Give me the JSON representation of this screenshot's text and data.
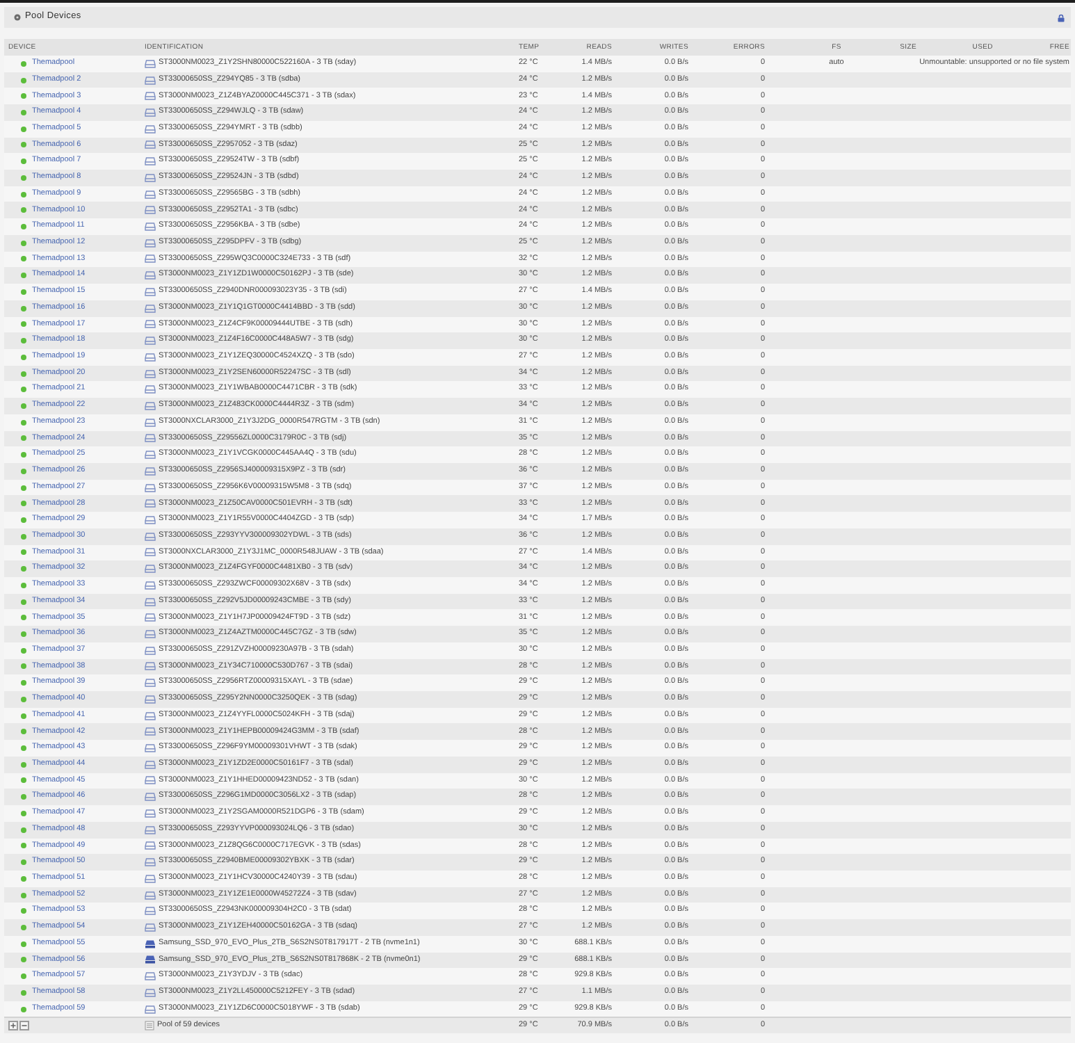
{
  "panel": {
    "title": "Pool Devices"
  },
  "table": {
    "columns": [
      "DEVICE",
      "IDENTIFICATION",
      "TEMP",
      "READS",
      "WRITES",
      "ERRORS",
      "FS",
      "SIZE",
      "USED",
      "FREE"
    ],
    "rows": [
      {
        "device": "Themadpool",
        "kind": "hdd",
        "identification": "ST3000NM0023_Z1Y2SHN80000C522160A - 3 TB (sday)",
        "temp": "22 °C",
        "reads": "1.4 MB/s",
        "writes": "0.0 B/s",
        "errors": "0",
        "fs": "auto",
        "mount_status": "Unmountable: unsupported or no file system"
      },
      {
        "device": "Themadpool 2",
        "kind": "hdd",
        "identification": "ST33000650SS_Z294YQ85 - 3 TB (sdba)",
        "temp": "24 °C",
        "reads": "1.2 MB/s",
        "writes": "0.0 B/s",
        "errors": "0"
      },
      {
        "device": "Themadpool 3",
        "kind": "hdd",
        "identification": "ST3000NM0023_Z1Z4BYAZ0000C445C371 - 3 TB (sdax)",
        "temp": "23 °C",
        "reads": "1.4 MB/s",
        "writes": "0.0 B/s",
        "errors": "0"
      },
      {
        "device": "Themadpool 4",
        "kind": "hdd",
        "identification": "ST33000650SS_Z294WJLQ - 3 TB (sdaw)",
        "temp": "24 °C",
        "reads": "1.2 MB/s",
        "writes": "0.0 B/s",
        "errors": "0"
      },
      {
        "device": "Themadpool 5",
        "kind": "hdd",
        "identification": "ST33000650SS_Z294YMRT - 3 TB (sdbb)",
        "temp": "24 °C",
        "reads": "1.2 MB/s",
        "writes": "0.0 B/s",
        "errors": "0"
      },
      {
        "device": "Themadpool 6",
        "kind": "hdd",
        "identification": "ST33000650SS_Z2957052 - 3 TB (sdaz)",
        "temp": "25 °C",
        "reads": "1.2 MB/s",
        "writes": "0.0 B/s",
        "errors": "0"
      },
      {
        "device": "Themadpool 7",
        "kind": "hdd",
        "identification": "ST33000650SS_Z29524TW - 3 TB (sdbf)",
        "temp": "25 °C",
        "reads": "1.2 MB/s",
        "writes": "0.0 B/s",
        "errors": "0"
      },
      {
        "device": "Themadpool 8",
        "kind": "hdd",
        "identification": "ST33000650SS_Z29524JN - 3 TB (sdbd)",
        "temp": "24 °C",
        "reads": "1.2 MB/s",
        "writes": "0.0 B/s",
        "errors": "0"
      },
      {
        "device": "Themadpool 9",
        "kind": "hdd",
        "identification": "ST33000650SS_Z29565BG - 3 TB (sdbh)",
        "temp": "24 °C",
        "reads": "1.2 MB/s",
        "writes": "0.0 B/s",
        "errors": "0"
      },
      {
        "device": "Themadpool 10",
        "kind": "hdd",
        "identification": "ST33000650SS_Z2952TA1 - 3 TB (sdbc)",
        "temp": "24 °C",
        "reads": "1.2 MB/s",
        "writes": "0.0 B/s",
        "errors": "0"
      },
      {
        "device": "Themadpool 11",
        "kind": "hdd",
        "identification": "ST33000650SS_Z2956KBA - 3 TB (sdbe)",
        "temp": "24 °C",
        "reads": "1.2 MB/s",
        "writes": "0.0 B/s",
        "errors": "0"
      },
      {
        "device": "Themadpool 12",
        "kind": "hdd",
        "identification": "ST33000650SS_Z295DPFV - 3 TB (sdbg)",
        "temp": "25 °C",
        "reads": "1.2 MB/s",
        "writes": "0.0 B/s",
        "errors": "0"
      },
      {
        "device": "Themadpool 13",
        "kind": "hdd",
        "identification": "ST33000650SS_Z295WQ3C0000C324E733 - 3 TB (sdf)",
        "temp": "32 °C",
        "reads": "1.2 MB/s",
        "writes": "0.0 B/s",
        "errors": "0"
      },
      {
        "device": "Themadpool 14",
        "kind": "hdd",
        "identification": "ST3000NM0023_Z1Y1ZD1W0000C50162PJ - 3 TB (sde)",
        "temp": "30 °C",
        "reads": "1.2 MB/s",
        "writes": "0.0 B/s",
        "errors": "0"
      },
      {
        "device": "Themadpool 15",
        "kind": "hdd",
        "identification": "ST33000650SS_Z2940DNR000093023Y35 - 3 TB (sdi)",
        "temp": "27 °C",
        "reads": "1.4 MB/s",
        "writes": "0.0 B/s",
        "errors": "0"
      },
      {
        "device": "Themadpool 16",
        "kind": "hdd",
        "identification": "ST3000NM0023_Z1Y1Q1GT0000C4414BBD - 3 TB (sdd)",
        "temp": "30 °C",
        "reads": "1.2 MB/s",
        "writes": "0.0 B/s",
        "errors": "0"
      },
      {
        "device": "Themadpool 17",
        "kind": "hdd",
        "identification": "ST3000NM0023_Z1Z4CF9K00009444UTBE - 3 TB (sdh)",
        "temp": "30 °C",
        "reads": "1.2 MB/s",
        "writes": "0.0 B/s",
        "errors": "0"
      },
      {
        "device": "Themadpool 18",
        "kind": "hdd",
        "identification": "ST3000NM0023_Z1Z4F16C0000C448A5W7 - 3 TB (sdg)",
        "temp": "30 °C",
        "reads": "1.2 MB/s",
        "writes": "0.0 B/s",
        "errors": "0"
      },
      {
        "device": "Themadpool 19",
        "kind": "hdd",
        "identification": "ST3000NM0023_Z1Y1ZEQ30000C4524XZQ - 3 TB (sdo)",
        "temp": "27 °C",
        "reads": "1.2 MB/s",
        "writes": "0.0 B/s",
        "errors": "0"
      },
      {
        "device": "Themadpool 20",
        "kind": "hdd",
        "identification": "ST3000NM0023_Z1Y2SEN60000R52247SC - 3 TB (sdl)",
        "temp": "34 °C",
        "reads": "1.2 MB/s",
        "writes": "0.0 B/s",
        "errors": "0"
      },
      {
        "device": "Themadpool 21",
        "kind": "hdd",
        "identification": "ST3000NM0023_Z1Y1WBAB0000C4471CBR - 3 TB (sdk)",
        "temp": "33 °C",
        "reads": "1.2 MB/s",
        "writes": "0.0 B/s",
        "errors": "0"
      },
      {
        "device": "Themadpool 22",
        "kind": "hdd",
        "identification": "ST3000NM0023_Z1Z483CK0000C4444R3Z - 3 TB (sdm)",
        "temp": "34 °C",
        "reads": "1.2 MB/s",
        "writes": "0.0 B/s",
        "errors": "0"
      },
      {
        "device": "Themadpool 23",
        "kind": "hdd",
        "identification": "ST3000NXCLAR3000_Z1Y3J2DG_0000R547RGTM - 3 TB (sdn)",
        "temp": "31 °C",
        "reads": "1.2 MB/s",
        "writes": "0.0 B/s",
        "errors": "0"
      },
      {
        "device": "Themadpool 24",
        "kind": "hdd",
        "identification": "ST33000650SS_Z29556ZL0000C3179R0C - 3 TB (sdj)",
        "temp": "35 °C",
        "reads": "1.2 MB/s",
        "writes": "0.0 B/s",
        "errors": "0"
      },
      {
        "device": "Themadpool 25",
        "kind": "hdd",
        "identification": "ST3000NM0023_Z1Y1VCGK0000C445AA4Q - 3 TB (sdu)",
        "temp": "28 °C",
        "reads": "1.2 MB/s",
        "writes": "0.0 B/s",
        "errors": "0"
      },
      {
        "device": "Themadpool 26",
        "kind": "hdd",
        "identification": "ST33000650SS_Z2956SJ400009315X9PZ - 3 TB (sdr)",
        "temp": "36 °C",
        "reads": "1.2 MB/s",
        "writes": "0.0 B/s",
        "errors": "0"
      },
      {
        "device": "Themadpool 27",
        "kind": "hdd",
        "identification": "ST33000650SS_Z2956K6V00009315W5M8 - 3 TB (sdq)",
        "temp": "37 °C",
        "reads": "1.2 MB/s",
        "writes": "0.0 B/s",
        "errors": "0"
      },
      {
        "device": "Themadpool 28",
        "kind": "hdd",
        "identification": "ST3000NM0023_Z1Z50CAV0000C501EVRH - 3 TB (sdt)",
        "temp": "33 °C",
        "reads": "1.2 MB/s",
        "writes": "0.0 B/s",
        "errors": "0"
      },
      {
        "device": "Themadpool 29",
        "kind": "hdd",
        "identification": "ST3000NM0023_Z1Y1R55V0000C4404ZGD - 3 TB (sdp)",
        "temp": "34 °C",
        "reads": "1.7 MB/s",
        "writes": "0.0 B/s",
        "errors": "0"
      },
      {
        "device": "Themadpool 30",
        "kind": "hdd",
        "identification": "ST33000650SS_Z293YYV300009302YDWL - 3 TB (sds)",
        "temp": "36 °C",
        "reads": "1.2 MB/s",
        "writes": "0.0 B/s",
        "errors": "0"
      },
      {
        "device": "Themadpool 31",
        "kind": "hdd",
        "identification": "ST3000NXCLAR3000_Z1Y3J1MC_0000R548JUAW - 3 TB (sdaa)",
        "temp": "27 °C",
        "reads": "1.4 MB/s",
        "writes": "0.0 B/s",
        "errors": "0"
      },
      {
        "device": "Themadpool 32",
        "kind": "hdd",
        "identification": "ST3000NM0023_Z1Z4FGYF0000C4481XB0 - 3 TB (sdv)",
        "temp": "34 °C",
        "reads": "1.2 MB/s",
        "writes": "0.0 B/s",
        "errors": "0"
      },
      {
        "device": "Themadpool 33",
        "kind": "hdd",
        "identification": "ST33000650SS_Z293ZWCF00009302X68V - 3 TB (sdx)",
        "temp": "34 °C",
        "reads": "1.2 MB/s",
        "writes": "0.0 B/s",
        "errors": "0"
      },
      {
        "device": "Themadpool 34",
        "kind": "hdd",
        "identification": "ST33000650SS_Z292V5JD00009243CMBE - 3 TB (sdy)",
        "temp": "33 °C",
        "reads": "1.2 MB/s",
        "writes": "0.0 B/s",
        "errors": "0"
      },
      {
        "device": "Themadpool 35",
        "kind": "hdd",
        "identification": "ST3000NM0023_Z1Y1H7JP00009424FT9D - 3 TB (sdz)",
        "temp": "31 °C",
        "reads": "1.2 MB/s",
        "writes": "0.0 B/s",
        "errors": "0"
      },
      {
        "device": "Themadpool 36",
        "kind": "hdd",
        "identification": "ST3000NM0023_Z1Z4AZTM0000C445C7GZ - 3 TB (sdw)",
        "temp": "35 °C",
        "reads": "1.2 MB/s",
        "writes": "0.0 B/s",
        "errors": "0"
      },
      {
        "device": "Themadpool 37",
        "kind": "hdd",
        "identification": "ST33000650SS_Z291ZVZH00009230A97B - 3 TB (sdah)",
        "temp": "30 °C",
        "reads": "1.2 MB/s",
        "writes": "0.0 B/s",
        "errors": "0"
      },
      {
        "device": "Themadpool 38",
        "kind": "hdd",
        "identification": "ST3000NM0023_Z1Y34C710000C530D767 - 3 TB (sdai)",
        "temp": "28 °C",
        "reads": "1.2 MB/s",
        "writes": "0.0 B/s",
        "errors": "0"
      },
      {
        "device": "Themadpool 39",
        "kind": "hdd",
        "identification": "ST33000650SS_Z2956RTZ00009315XAYL - 3 TB (sdae)",
        "temp": "29 °C",
        "reads": "1.2 MB/s",
        "writes": "0.0 B/s",
        "errors": "0"
      },
      {
        "device": "Themadpool 40",
        "kind": "hdd",
        "identification": "ST33000650SS_Z295Y2NN0000C3250QEK - 3 TB (sdag)",
        "temp": "29 °C",
        "reads": "1.2 MB/s",
        "writes": "0.0 B/s",
        "errors": "0"
      },
      {
        "device": "Themadpool 41",
        "kind": "hdd",
        "identification": "ST3000NM0023_Z1Z4YYFL0000C5024KFH - 3 TB (sdaj)",
        "temp": "29 °C",
        "reads": "1.2 MB/s",
        "writes": "0.0 B/s",
        "errors": "0"
      },
      {
        "device": "Themadpool 42",
        "kind": "hdd",
        "identification": "ST3000NM0023_Z1Y1HEPB00009424G3MM - 3 TB (sdaf)",
        "temp": "28 °C",
        "reads": "1.2 MB/s",
        "writes": "0.0 B/s",
        "errors": "0"
      },
      {
        "device": "Themadpool 43",
        "kind": "hdd",
        "identification": "ST33000650SS_Z296F9YM00009301VHWT - 3 TB (sdak)",
        "temp": "29 °C",
        "reads": "1.2 MB/s",
        "writes": "0.0 B/s",
        "errors": "0"
      },
      {
        "device": "Themadpool 44",
        "kind": "hdd",
        "identification": "ST3000NM0023_Z1Y1ZD2E0000C50161F7 - 3 TB (sdal)",
        "temp": "29 °C",
        "reads": "1.2 MB/s",
        "writes": "0.0 B/s",
        "errors": "0"
      },
      {
        "device": "Themadpool 45",
        "kind": "hdd",
        "identification": "ST3000NM0023_Z1Y1HHED00009423ND52 - 3 TB (sdan)",
        "temp": "30 °C",
        "reads": "1.2 MB/s",
        "writes": "0.0 B/s",
        "errors": "0"
      },
      {
        "device": "Themadpool 46",
        "kind": "hdd",
        "identification": "ST33000650SS_Z296G1MD0000C3056LX2 - 3 TB (sdap)",
        "temp": "28 °C",
        "reads": "1.2 MB/s",
        "writes": "0.0 B/s",
        "errors": "0"
      },
      {
        "device": "Themadpool 47",
        "kind": "hdd",
        "identification": "ST3000NM0023_Z1Y2SGAM0000R521DGP6 - 3 TB (sdam)",
        "temp": "29 °C",
        "reads": "1.2 MB/s",
        "writes": "0.0 B/s",
        "errors": "0"
      },
      {
        "device": "Themadpool 48",
        "kind": "hdd",
        "identification": "ST33000650SS_Z293YYVP000093024LQ6 - 3 TB (sdao)",
        "temp": "30 °C",
        "reads": "1.2 MB/s",
        "writes": "0.0 B/s",
        "errors": "0"
      },
      {
        "device": "Themadpool 49",
        "kind": "hdd",
        "identification": "ST3000NM0023_Z1Z8QG6C0000C717EGVK - 3 TB (sdas)",
        "temp": "28 °C",
        "reads": "1.2 MB/s",
        "writes": "0.0 B/s",
        "errors": "0"
      },
      {
        "device": "Themadpool 50",
        "kind": "hdd",
        "identification": "ST33000650SS_Z2940BME00009302YBXK - 3 TB (sdar)",
        "temp": "29 °C",
        "reads": "1.2 MB/s",
        "writes": "0.0 B/s",
        "errors": "0"
      },
      {
        "device": "Themadpool 51",
        "kind": "hdd",
        "identification": "ST3000NM0023_Z1Y1HCV30000C4240Y39 - 3 TB (sdau)",
        "temp": "28 °C",
        "reads": "1.2 MB/s",
        "writes": "0.0 B/s",
        "errors": "0"
      },
      {
        "device": "Themadpool 52",
        "kind": "hdd",
        "identification": "ST3000NM0023_Z1Y1ZE1E0000W45272Z4 - 3 TB (sdav)",
        "temp": "27 °C",
        "reads": "1.2 MB/s",
        "writes": "0.0 B/s",
        "errors": "0"
      },
      {
        "device": "Themadpool 53",
        "kind": "hdd",
        "identification": "ST33000650SS_Z2943NK000009304H2C0 - 3 TB (sdat)",
        "temp": "28 °C",
        "reads": "1.2 MB/s",
        "writes": "0.0 B/s",
        "errors": "0"
      },
      {
        "device": "Themadpool 54",
        "kind": "hdd",
        "identification": "ST3000NM0023_Z1Y1ZEH40000C50162GA - 3 TB (sdaq)",
        "temp": "27 °C",
        "reads": "1.2 MB/s",
        "writes": "0.0 B/s",
        "errors": "0"
      },
      {
        "device": "Themadpool 55",
        "kind": "nvme",
        "identification": "Samsung_SSD_970_EVO_Plus_2TB_S6S2NS0T817917T - 2 TB (nvme1n1)",
        "temp": "30 °C",
        "reads": "688.1 KB/s",
        "writes": "0.0 B/s",
        "errors": "0"
      },
      {
        "device": "Themadpool 56",
        "kind": "nvme",
        "identification": "Samsung_SSD_970_EVO_Plus_2TB_S6S2NS0T817868K - 2 TB (nvme0n1)",
        "temp": "29 °C",
        "reads": "688.1 KB/s",
        "writes": "0.0 B/s",
        "errors": "0"
      },
      {
        "device": "Themadpool 57",
        "kind": "hdd",
        "identification": "ST3000NM0023_Z1Y3YDJV - 3 TB (sdac)",
        "temp": "28 °C",
        "reads": "929.8 KB/s",
        "writes": "0.0 B/s",
        "errors": "0"
      },
      {
        "device": "Themadpool 58",
        "kind": "hdd",
        "identification": "ST3000NM0023_Z1Y2LL450000C5212FEY - 3 TB (sdad)",
        "temp": "27 °C",
        "reads": "1.1 MB/s",
        "writes": "0.0 B/s",
        "errors": "0"
      },
      {
        "device": "Themadpool 59",
        "kind": "hdd",
        "identification": "ST3000NM0023_Z1Y1ZD6C0000C5018YWF - 3 TB (sdab)",
        "temp": "29 °C",
        "reads": "929.8 KB/s",
        "writes": "0.0 B/s",
        "errors": "0"
      }
    ],
    "footer": {
      "label": "Pool of 59 devices",
      "temp": "29 °C",
      "reads": "70.9 MB/s",
      "writes": "0.0 B/s",
      "errors": "0"
    }
  }
}
